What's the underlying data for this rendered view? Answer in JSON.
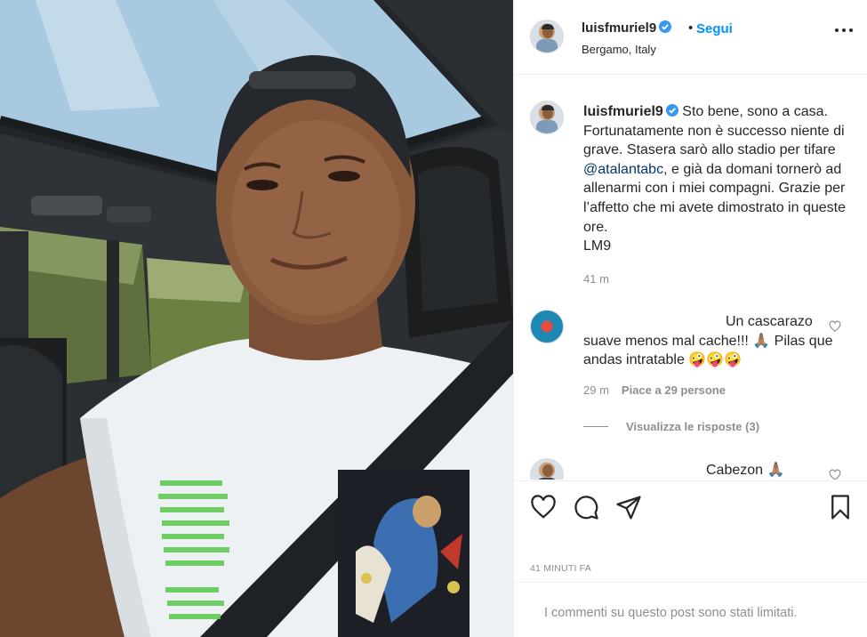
{
  "post": {
    "photo_alt": "",
    "username": "luisfmuriel9",
    "verified": true,
    "separator": "•",
    "follow_label": "Segui",
    "location": "Bergamo, Italy",
    "more_icon": "more-options-icon"
  },
  "caption": {
    "username": "luisfmuriel9",
    "text_before_mention": "Sto bene, sono a casa. Fortunatamente non è successo niente di grave. Stasera sarò allo stadio per tifare ",
    "mention": "@atalantabc",
    "text_after_mention": ", e già da domani tornerò ad allenarmi con i miei compagni. Grazie per l’affetto che mi avete dimostrato in queste ore.",
    "signature": "LM9",
    "time": "41 m"
  },
  "comments": [
    {
      "text": "Un cascarazo suave menos mal cache!!! 🙏🏽 Pilas que andas intratable 🤪🤪🤪",
      "time": "29 m",
      "likes": "Piace a 29 persone",
      "replies_label": "Visualizza le risposte (3)"
    },
    {
      "text": "Cabezon 🙏🏽"
    }
  ],
  "actions": {
    "like_icon": "heart-icon",
    "comment_icon": "comment-icon",
    "share_icon": "paper-plane-icon",
    "save_icon": "bookmark-icon"
  },
  "timestamp_label": "41 MINUTI FA",
  "comments_limited": "I commenti su questo post sono stati limitati.",
  "colors": {
    "link_blue": "#0095f6",
    "mention_blue": "#00376b",
    "secondary_text": "#8e8e8e",
    "border": "#efefef"
  }
}
